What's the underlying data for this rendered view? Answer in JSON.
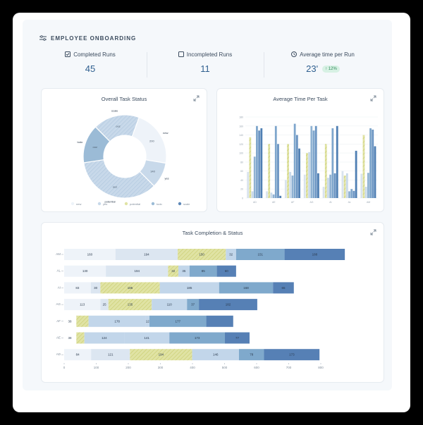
{
  "header": {
    "title": "EMPLOYEE ONBOARDING",
    "icon": "sliders-icon"
  },
  "stats": {
    "completed": {
      "label": "Completed Runs",
      "value": "45",
      "icon": "checkbox-checked-icon"
    },
    "incompleted": {
      "label": "Incompleted Runs",
      "value": "11",
      "icon": "checkbox-empty-icon"
    },
    "avg_time": {
      "label": "Average time per Run",
      "value": "23'",
      "badge": "12%",
      "icon": "clock-icon"
    }
  },
  "cards": {
    "donut": {
      "title": "Overall Task Status"
    },
    "avg_time": {
      "title": "Average Time Per Task"
    },
    "completion": {
      "title": "Task Completion & Status"
    }
  },
  "colors": {
    "new": "#eef3f9",
    "yes": "#c8d9ea",
    "potential": "#e0e3a4",
    "todo": "#9bbbd6",
    "todo2": "#5f89b8",
    "accent": "#2f5f8f"
  },
  "chart_data": [
    {
      "type": "pie",
      "title": "Overall Task Status",
      "slices": [
        {
          "name": "new",
          "value": 22
        },
        {
          "name": "yes",
          "value": 10
        },
        {
          "name": "potential",
          "value": 35
        },
        {
          "name": "todo",
          "value": 15
        },
        {
          "name": "scale",
          "value": 18
        }
      ],
      "slice_labels": [
        "200",
        "140",
        "ooz",
        "ooz",
        "ooz"
      ],
      "outer_labels": [
        "new",
        "yes",
        "potential",
        "todo",
        "scale"
      ],
      "legend": [
        "new",
        "yes",
        "potential",
        "todo",
        "scale"
      ]
    },
    {
      "type": "bar",
      "title": "Average Time Per Task",
      "categories": [
        "AD",
        "AE",
        "AF",
        "AG",
        "AI",
        "AL",
        "AM"
      ],
      "ylim": [
        0,
        180
      ],
      "yticks": [
        "0",
        "20",
        "40",
        "60",
        "80",
        "100",
        "120",
        "140",
        "160",
        "180"
      ],
      "series": [
        {
          "values": [
            58,
            15,
            40,
            52,
            25,
            60,
            54
          ]
        },
        {
          "values": [
            135,
            120,
            120,
            100,
            120,
            50,
            140
          ]
        },
        {
          "values": [
            15,
            12,
            58,
            102,
            45,
            55,
            25
          ]
        },
        {
          "values": [
            92,
            8,
            50,
            160,
            52,
            15,
            56
          ]
        },
        {
          "values": [
            160,
            160,
            165,
            150,
            155,
            20,
            155
          ]
        },
        {
          "values": [
            150,
            120,
            140,
            160,
            55,
            16,
            152
          ]
        },
        {
          "values": [
            155,
            5,
            110,
            55,
            160,
            105,
            115
          ]
        }
      ]
    },
    {
      "type": "bar",
      "title": "Task Completion & Status",
      "orientation": "horizontal",
      "stacked": true,
      "categories": [
        "AM",
        "AL",
        "AI",
        "AG",
        "AF",
        "AE",
        "AD"
      ],
      "category_prefix_labels": [
        "",
        "",
        "",
        "",
        "38",
        "38",
        ""
      ],
      "xlim": [
        0,
        800
      ],
      "xticks": [
        "0",
        "100",
        "200",
        "300",
        "400",
        "500",
        "600",
        "700",
        "800"
      ],
      "rows": [
        {
          "values": [
            160,
            194,
            150,
            32,
            151,
            188
          ],
          "labels": [
            "160",
            "194",
            "150",
            "32",
            "151",
            "188"
          ]
        },
        {
          "values": [
            130,
            194,
            32,
            35,
            85,
            60
          ],
          "labels": [
            "130",
            "194",
            "32",
            "35",
            "85",
            "60"
          ]
        },
        {
          "values": [
            83,
            30,
            185,
            185,
            168,
            65
          ],
          "labels": [
            "83",
            "30",
            "185",
            "185",
            "168",
            "65"
          ]
        },
        {
          "values": [
            113,
            25,
            135,
            110,
            37,
            182
          ],
          "labels": [
            "113",
            "25",
            "135",
            "110",
            "37",
            "182"
          ]
        },
        {
          "values": [
            38,
            178,
            12,
            177,
            84
          ],
          "labels": [
            "",
            "178",
            "12",
            "177",
            ""
          ],
          "offset": 38
        },
        {
          "values": [
            25,
            124,
            141,
            173,
            77
          ],
          "labels": [
            "",
            "124",
            "141",
            "173",
            "77"
          ],
          "offset": 38
        },
        {
          "values": [
            84,
            121,
            194,
            146,
            78,
            173
          ],
          "labels": [
            "84",
            "121",
            "194",
            "146",
            "78",
            "173"
          ]
        }
      ]
    }
  ]
}
